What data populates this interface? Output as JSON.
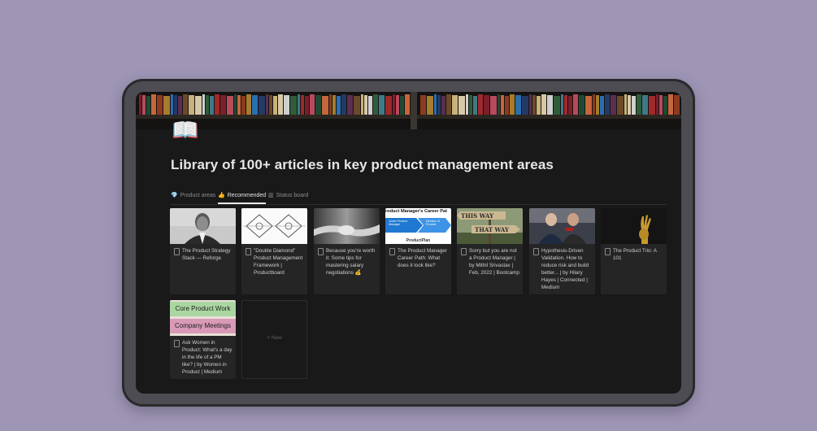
{
  "page": {
    "icon": "open-book-icon",
    "icon_glyph": "📖",
    "title": "Library of 100+ articles in key product management areas"
  },
  "tabs": [
    {
      "label": "Product areas",
      "icon": "gem-icon",
      "glyph": "💎",
      "active": false
    },
    {
      "label": "Recommended",
      "icon": "thumbs-up-icon",
      "glyph": "👍",
      "active": true
    },
    {
      "label": "Status board",
      "icon": "board-icon",
      "glyph": "▥",
      "active": false
    }
  ],
  "cards": [
    {
      "title": "The Product Strategy Stack — Reforge",
      "thumb": "portrait-photo"
    },
    {
      "title": "\"Double Diamond\" Product Management Framework | Productboard",
      "thumb": "diamond-diagram"
    },
    {
      "title": "Because you're worth it: Some tips for mastering salary negotiations 💰",
      "thumb": "handshake-photo"
    },
    {
      "title": "The Product Manager Career Path: What does it look like?",
      "thumb": "career-path-graphic"
    },
    {
      "title": "Sorry but you are not a Product Manager | by Mithil Srivastav | Feb, 2022 | Bootcamp",
      "thumb": "this-way-that-way-signs"
    },
    {
      "title": "Hypothesis-Driven Validation. How to reduce risk and build better... | by Hilary Hayes | Connected | Medium",
      "thumb": "two-people-photo"
    },
    {
      "title": "The Product Trio: A 101",
      "thumb": "three-fingers-photo"
    },
    {
      "title": "Ask Women in Product: What's a day in the life of a PM like? | by Women in Product | Medium",
      "thumb": "sticky-labels"
    }
  ],
  "thumb_text": {
    "career_header": "roduct Manager's Career Pat",
    "career_brand": "ProductPlan",
    "career_step1": "Junior Product Manager",
    "career_step2": "Director of Product",
    "sign_top": "THIS WAY",
    "sign_bottom": "THAT WAY",
    "label_green": "Core Product Work",
    "label_pink": "Company Meetings"
  },
  "new_button": {
    "label": "+ New"
  },
  "colors": {
    "background": "#9f96b6",
    "screen": "#191919",
    "card": "#252525",
    "text": "#e6e6e6"
  }
}
